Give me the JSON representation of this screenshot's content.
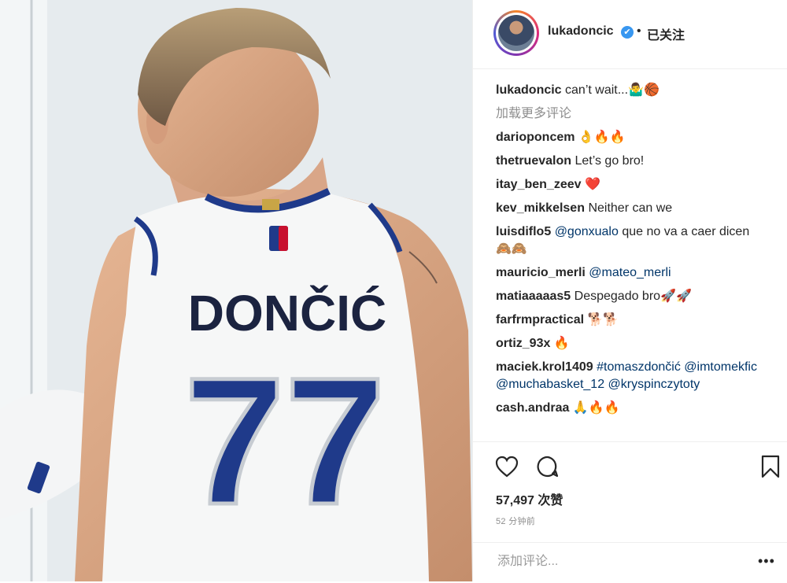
{
  "post": {
    "jersey_name": "DONČIĆ",
    "jersey_number": "77"
  },
  "header": {
    "username": "lukadoncic",
    "verified_icon": "✔",
    "separator": "•",
    "follow_status": "已关注"
  },
  "caption": {
    "username": "lukadoncic",
    "text": "can’t wait...🤷‍♂️🏀"
  },
  "load_more": "加载更多评论",
  "comments": [
    {
      "user": "darioponcem",
      "text": "👌🔥🔥"
    },
    {
      "user": "thetruevalon",
      "text": "Let’s go bro!"
    },
    {
      "user": "itay_ben_zeev",
      "text": "❤️"
    },
    {
      "user": "kev_mikkelsen",
      "text": "Neither can we"
    },
    {
      "user": "luisdiflo5",
      "mention": "@gonxualo",
      "text": "que no va a caer dicen 🙈🙈"
    },
    {
      "user": "mauricio_merli",
      "mention": "@mateo_merli",
      "text": ""
    },
    {
      "user": "matiaaaaas5",
      "text": "Despegado bro🚀🚀"
    },
    {
      "user": "farfrmpractical",
      "text": "🐕🐕"
    },
    {
      "user": "ortiz_93x",
      "text": "🔥"
    },
    {
      "user": "maciek.krol1409",
      "mention": "#tomaszdončić @imtomekfic @muchabasket_12 @kryspinczytoty",
      "text": ""
    },
    {
      "user": "cash.andraa",
      "text": "🙏🔥🔥"
    }
  ],
  "actions": {
    "like_icon": "heart-icon",
    "comment_icon": "comment-icon",
    "save_icon": "bookmark-icon",
    "likes": "57,497 次赞",
    "time": "52 分钟前"
  },
  "add_comment": {
    "placeholder": "添加评论...",
    "more": "•••"
  },
  "colors": {
    "link": "#003569",
    "muted": "#8e8e8e",
    "verified": "#3897f0",
    "jersey_blue": "#1f3a8a",
    "jersey_text": "#1b2340"
  }
}
